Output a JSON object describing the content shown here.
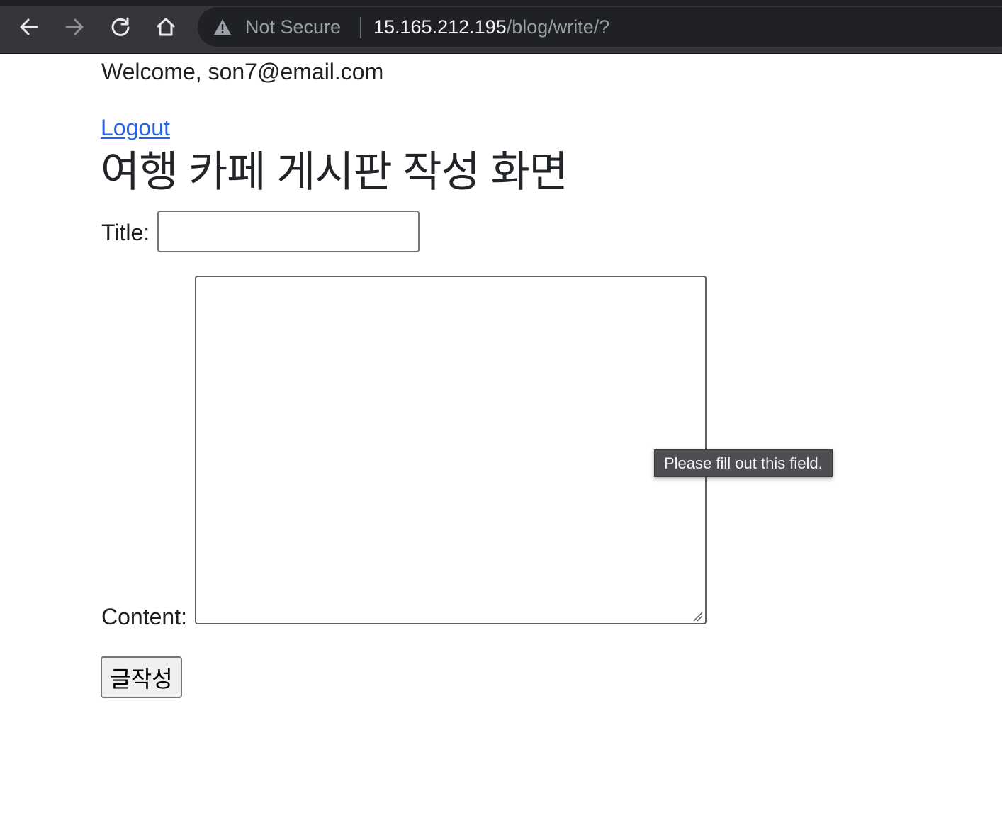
{
  "browser": {
    "security_label": "Not Secure",
    "url_host": "15.165.212.195",
    "url_path": "/blog/write/?",
    "icons": {
      "back": "arrow-left-icon",
      "forward": "arrow-right-icon",
      "reload": "reload-icon",
      "home": "home-icon",
      "security": "warning-triangle-icon"
    },
    "colors": {
      "toolbar": "#35363a",
      "omnibox": "#202124",
      "link": "#2563eb"
    }
  },
  "page": {
    "welcome_text": "Welcome, son7@email.com",
    "logout_label": "Logout",
    "title": "여행 카페 게시판 작성 화면",
    "form": {
      "title_label": "Title:",
      "title_value": "",
      "content_label": "Content:",
      "content_value": "",
      "submit_label": "글작성"
    },
    "validation_tooltip": "Please fill out this field."
  }
}
